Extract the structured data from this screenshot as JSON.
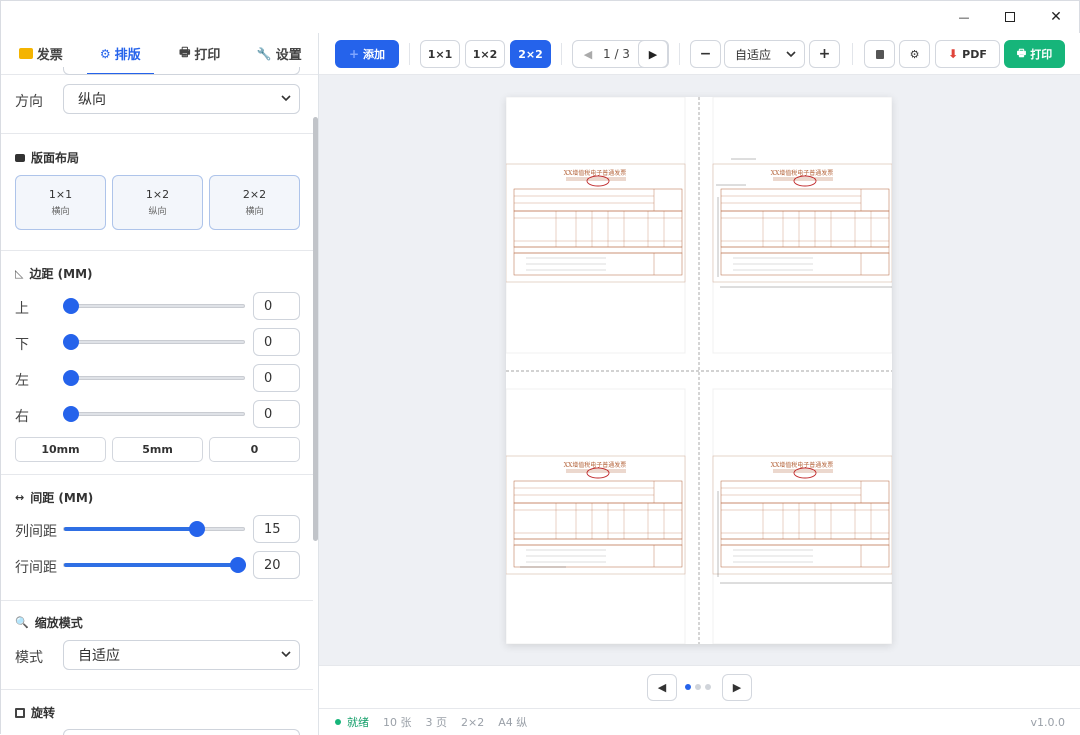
{
  "titlebar": {
    "minimize": "—",
    "maximize": "☐",
    "close": "✕"
  },
  "sidebar": {
    "tabs": [
      {
        "label": "发票",
        "icon": "folder-icon"
      },
      {
        "label": "排版",
        "icon": "gear-icon"
      },
      {
        "label": "打印",
        "icon": "printer-icon"
      },
      {
        "label": "设置",
        "icon": "wrench-icon"
      }
    ],
    "orientation": {
      "label": "方向",
      "value": "纵向"
    },
    "layout_section": {
      "title": "版面布局",
      "cards": [
        {
          "name": "1×1",
          "orient": "横向"
        },
        {
          "name": "1×2",
          "orient": "纵向"
        },
        {
          "name": "2×2",
          "orient": "横向"
        }
      ]
    },
    "margin_section": {
      "title": "边距 (MM)",
      "rows": [
        {
          "label": "上",
          "value": "0",
          "level": 0
        },
        {
          "label": "下",
          "value": "0",
          "level": 0
        },
        {
          "label": "左",
          "value": "0",
          "level": 0
        },
        {
          "label": "右",
          "value": "0",
          "level": 0
        }
      ],
      "presets": [
        "10mm",
        "5mm",
        "0"
      ]
    },
    "gap_section": {
      "title": "间距 (MM)",
      "rows": [
        {
          "label": "列间距",
          "value": "15",
          "level": 0.74
        },
        {
          "label": "行间距",
          "value": "20",
          "level": 1.0
        }
      ]
    },
    "scale_section": {
      "title": "缩放模式",
      "label": "模式",
      "value": "自适应"
    },
    "rotate_section": {
      "title": "旋转"
    }
  },
  "toolbar": {
    "add": "添加",
    "layouts": [
      "1×1",
      "1×2",
      "2×2"
    ],
    "active_layout": "2×2",
    "page_indicator": "1 / 3",
    "zoom": "自适应",
    "zoom_minus": "−",
    "zoom_plus": "+",
    "pdf": "PDF",
    "print": "打印"
  },
  "preview": {
    "invoice_title": "XX增值税电子普通发票",
    "invoice_count": 4
  },
  "pager": {
    "prev": "◀",
    "next": "▶",
    "dots": 3,
    "active_dot": 0
  },
  "status": {
    "state": "就绪",
    "count": "10 张",
    "pages": "3 页",
    "layout": "2×2",
    "paper": "A4 纵",
    "version": "v1.0.0"
  },
  "colors": {
    "accent": "#2563eb",
    "green": "#16b57a",
    "invoice_line": "#b5653c",
    "stamp": "#c0282a"
  }
}
